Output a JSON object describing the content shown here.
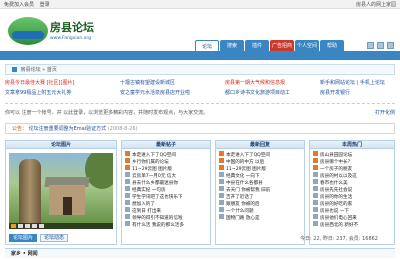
{
  "topbar": {
    "links": [
      "免费加入会员",
      "登录"
    ],
    "right_text": "房县人的网上家园"
  },
  "header": {
    "site_name": "房县论坛",
    "site_url": "www.Fangxian.org"
  },
  "nav": {
    "tabs": [
      {
        "label": "论坛",
        "state": "active"
      },
      {
        "label": "搜索",
        "state": ""
      },
      {
        "label": "插件",
        "state": ""
      },
      {
        "label": "广告招商",
        "state": "red"
      },
      {
        "label": "个人空间",
        "state": ""
      },
      {
        "label": "帮助",
        "state": ""
      }
    ]
  },
  "breadcrumb": {
    "text": "房县论坛 » 首页"
  },
  "links": {
    "rows": [
      [
        "房县今日最佳大赛 [社区][图片]",
        "十堰古镇有望建设新城区",
        "房县第一期大气候和信息报",
        "新手和网站论坛 | 手机上论坛"
      ],
      [
        "文章拿99极品上附五元大礼券",
        "安之童学元水活泉房县店开业啦",
        "都口乡诗书文化旅游项目动工",
        "房县开发银行"
      ]
    ]
  },
  "status": {
    "text": "你可以 注册一个帐号，并 以此登录，以浏览更多精彩内容，并随时发布观点，与大家交流。",
    "right": "打开化侧"
  },
  "notice": {
    "label": "公告：",
    "title": "论坛注册重要调整为Emai验证方式",
    "date": "(2008-8-26)"
  },
  "panels": {
    "p1": {
      "title": "论坛图片",
      "buttons": [
        "论坛图片",
        "论坛动态"
      ]
    },
    "p2": {
      "title": "最新帖子",
      "items": [
        "本走进入下了QQ空间",
        "乡行你们属的论坛",
        "11~29云图 图片版",
        "云房单7一月0元 信大",
        "县去什么乡都最迷县你",
        "经典实纪 一句房",
        "学生学讯吧了这也快乐下",
        "想加入的了",
        "这到日 打出来",
        "领导的得引不知道的信啦",
        "有什么活 我说的那么活多"
      ]
    },
    "p3": {
      "title": "最新回复",
      "items": [
        "本走进入下了QQ空间",
        "中国的的中方 以后",
        "11~29云图 图片版",
        "经典文化 一向下",
        "中县在什么各都县",
        "去天门 你被帮我 旧前",
        "吉开了近话了",
        "跟朋友 你被的后",
        "一个什么问题",
        "国物门路 放心是"
      ]
    },
    "p4": {
      "title": "本周热门",
      "items": [
        "房山县田园论坛",
        "房县哪个中长？",
        "一个房子的朋友",
        "房县的村以以及这",
        "春市也什么美",
        "房县先先社会说",
        "房县的你的生活",
        "房县的好吃的家",
        "房县也说 一下",
        "房县他们电心回来",
        "房县西北的 新好不"
      ]
    }
  },
  "stats": "今日: 22, 昨日: 237, 会员: 16862",
  "footer": {
    "text": "家乡 • 网闻"
  }
}
